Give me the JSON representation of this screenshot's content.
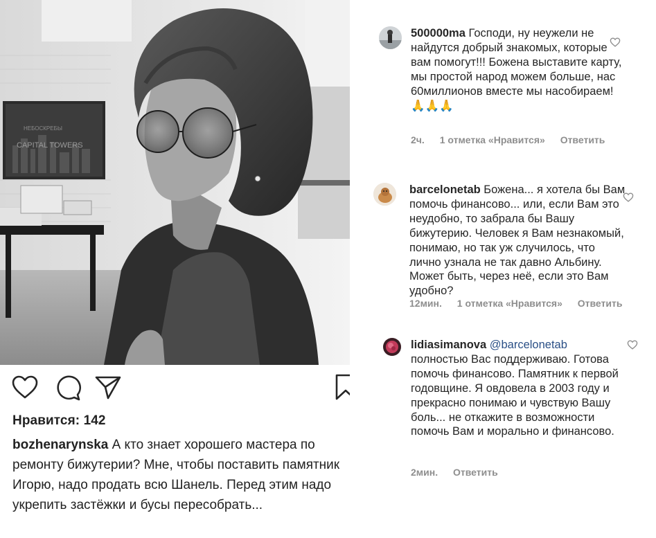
{
  "post": {
    "likes_text": "Нравится: 142",
    "author": "bozhenarynska",
    "caption": "А кто знает хорошего мастера по ремонту бижутерии? Мне, чтобы поставить памятник Игорю, надо продать всю Шанель. Перед этим надо укрепить застёжки и бусы пересобрать...",
    "photo_sign_line1": "НЕБОСКРЕБЫ",
    "photo_sign_line2": "CAPITAL TOWERS"
  },
  "icons": {
    "like": "heart-outline-icon",
    "comment": "comment-bubble-icon",
    "share": "paper-plane-icon",
    "save": "bookmark-icon"
  },
  "comments": [
    {
      "user": "500000ma",
      "text": "Господи, ну неужели не найдутся добрый знакомых, которые вам помогут!!! Божена выставите карту, мы простой народ можем больше, нас 60миллионов вместе мы насобираем! 🙏🙏🙏",
      "time": "2ч.",
      "likes": "1 отметка «Нравится»",
      "reply": "Ответить"
    },
    {
      "user": "barcelonetab",
      "text": "Божена... я хотела бы Вам помочь финансово... или, если Вам это неудобно, то забрала бы Вашу бижутерию. Человек я Вам незнакомый, понимаю, но так уж случилось, что лично узнала не так давно Альбину. Может быть, через неё, если это Вам удобно?",
      "time": "12мин.",
      "likes": "1 отметка «Нравится»",
      "reply": "Ответить"
    },
    {
      "user": "lidiasimanova",
      "mention": "@barcelonetab",
      "text": "полностью Вас поддерживаю. Готова помочь финансово. Памятник к первой годовщине. Я овдовела в 2003 году и прекрасно понимаю и чувствую Вашу боль... не откажите в возможности помочь Вам и морально и финансово.",
      "time": "2мин.",
      "reply": "Ответить"
    }
  ],
  "colors": {
    "text": "#262626",
    "meta": "#8e8e8e",
    "mention": "#2a4f86"
  }
}
